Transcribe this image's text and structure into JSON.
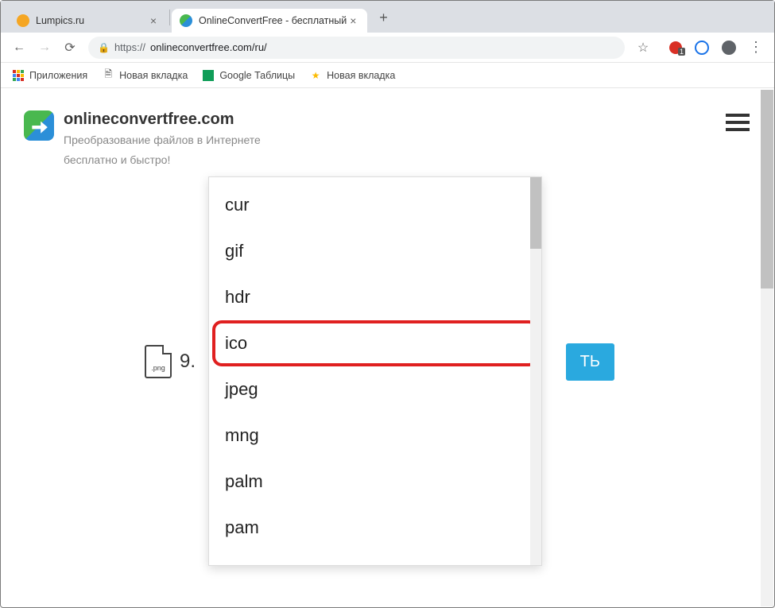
{
  "window": {
    "minimize": "—",
    "maximize": "☐",
    "close": "✕"
  },
  "tabs": [
    {
      "title": "Lumpics.ru",
      "favicon_color": "#f5a623",
      "active": false
    },
    {
      "title": "OnlineConvertFree - бесплатный",
      "favicon_color": "#3a9",
      "active": true
    }
  ],
  "newtab": "+",
  "nav": {
    "back": "←",
    "forward": "→",
    "reload": "⟳"
  },
  "url": {
    "scheme": "https://",
    "rest": "onlineconvertfree.com/ru/",
    "lock": "🔒"
  },
  "addr_icons": {
    "star": "☆",
    "kebab": "⋮"
  },
  "bookmarks": {
    "apps": "Приложения",
    "newtab1": "Новая вкладка",
    "gsheets": "Google Таблицы",
    "newtab2": "Новая вкладка"
  },
  "site": {
    "title": "onlineconvertfree.com",
    "sub1": "Преобразование файлов в Интернете",
    "sub2": "бесплатно и быстро!"
  },
  "file": {
    "ext": ".png",
    "number_prefix": "9."
  },
  "button": {
    "convert_suffix": "ТЬ"
  },
  "dropdown": {
    "items": [
      "cur",
      "gif",
      "hdr",
      "ico",
      "jpeg",
      "mng",
      "palm",
      "pam"
    ],
    "highlighted": "ico"
  }
}
